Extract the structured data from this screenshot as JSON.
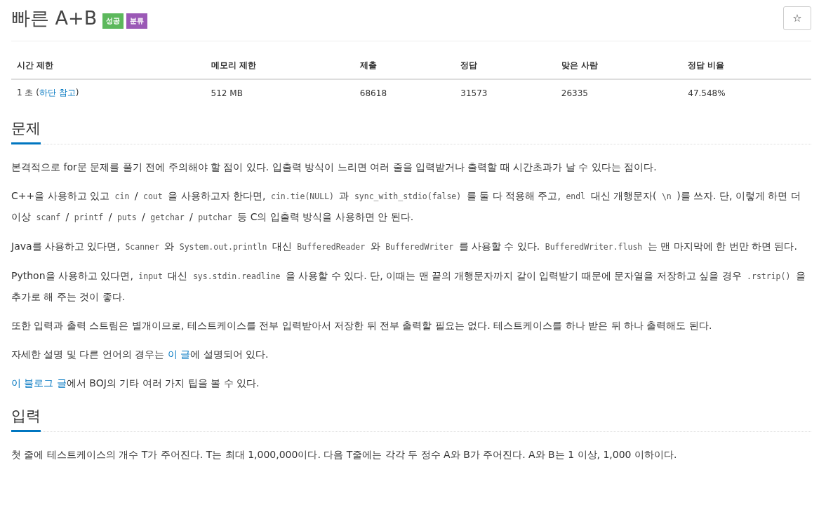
{
  "title": "빠른 A+B",
  "labels": [
    {
      "text": "성공",
      "color": "#5cb85c"
    },
    {
      "text": "분류",
      "color": "#9b59b6"
    }
  ],
  "star_button": "☆",
  "info_table": {
    "columns": [
      "시간 제한",
      "메모리 제한",
      "제출",
      "정답",
      "맞은 사람",
      "정답 비율"
    ],
    "row": [
      [
        {
          "kind": "text",
          "text": "1 초 ("
        },
        {
          "kind": "link",
          "text": "하단 참고"
        },
        {
          "kind": "text",
          "text": ")"
        }
      ],
      [
        {
          "kind": "text",
          "text": "512 MB"
        }
      ],
      [
        {
          "kind": "text",
          "text": "68618"
        }
      ],
      [
        {
          "kind": "text",
          "text": "31573"
        }
      ],
      [
        {
          "kind": "text",
          "text": "26335"
        }
      ],
      [
        {
          "kind": "text",
          "text": "47.548%"
        }
      ]
    ]
  },
  "sections": [
    {
      "heading": "문제",
      "paragraphs": [
        [
          {
            "kind": "text",
            "text": "본격적으로 for문 문제를 풀기 전에 주의해야 할 점이 있다. 입출력 방식이 느리면 여러 줄을 입력받거나 출력할 때 시간초과가 날 수 있다는 점이다."
          }
        ],
        [
          {
            "kind": "text",
            "text": "C++을 사용하고 있고 "
          },
          {
            "kind": "code",
            "text": "cin"
          },
          {
            "kind": "text",
            "text": " / "
          },
          {
            "kind": "code",
            "text": "cout"
          },
          {
            "kind": "text",
            "text": " 을 사용하고자 한다면, "
          },
          {
            "kind": "code",
            "text": "cin.tie(NULL)"
          },
          {
            "kind": "text",
            "text": " 과 "
          },
          {
            "kind": "code",
            "text": "sync_with_stdio(false)"
          },
          {
            "kind": "text",
            "text": " 를 둘 다 적용해 주고, "
          },
          {
            "kind": "code",
            "text": "endl"
          },
          {
            "kind": "text",
            "text": " 대신 개행문자( "
          },
          {
            "kind": "code",
            "text": "\\n"
          },
          {
            "kind": "text",
            "text": " )를 쓰자. 단, 이렇게 하면 더 이상 "
          },
          {
            "kind": "code",
            "text": "scanf"
          },
          {
            "kind": "text",
            "text": " / "
          },
          {
            "kind": "code",
            "text": "printf"
          },
          {
            "kind": "text",
            "text": " / "
          },
          {
            "kind": "code",
            "text": "puts"
          },
          {
            "kind": "text",
            "text": " / "
          },
          {
            "kind": "code",
            "text": "getchar"
          },
          {
            "kind": "text",
            "text": " / "
          },
          {
            "kind": "code",
            "text": "putchar"
          },
          {
            "kind": "text",
            "text": " 등 C의 입출력 방식을 사용하면 안 된다."
          }
        ],
        [
          {
            "kind": "text",
            "text": "Java를 사용하고 있다면, "
          },
          {
            "kind": "code",
            "text": "Scanner"
          },
          {
            "kind": "text",
            "text": " 와 "
          },
          {
            "kind": "code",
            "text": "System.out.println"
          },
          {
            "kind": "text",
            "text": " 대신 "
          },
          {
            "kind": "code",
            "text": "BufferedReader"
          },
          {
            "kind": "text",
            "text": " 와 "
          },
          {
            "kind": "code",
            "text": "BufferedWriter"
          },
          {
            "kind": "text",
            "text": " 를 사용할 수 있다. "
          },
          {
            "kind": "code",
            "text": "BufferedWriter.flush"
          },
          {
            "kind": "text",
            "text": " 는 맨 마지막에 한 번만 하면 된다."
          }
        ],
        [
          {
            "kind": "text",
            "text": "Python을 사용하고 있다면, "
          },
          {
            "kind": "code",
            "text": "input"
          },
          {
            "kind": "text",
            "text": " 대신 "
          },
          {
            "kind": "code",
            "text": "sys.stdin.readline"
          },
          {
            "kind": "text",
            "text": " 을 사용할 수 있다. 단, 이때는 맨 끝의 개행문자까지 같이 입력받기 때문에 문자열을 저장하고 싶을 경우 "
          },
          {
            "kind": "code",
            "text": ".rstrip()"
          },
          {
            "kind": "text",
            "text": " 을 추가로 해 주는 것이 좋다."
          }
        ],
        [
          {
            "kind": "text",
            "text": "또한 입력과 출력 스트림은 별개이므로, 테스트케이스를 전부 입력받아서 저장한 뒤 전부 출력할 필요는 없다. 테스트케이스를 하나 받은 뒤 하나 출력해도 된다."
          }
        ],
        [
          {
            "kind": "text",
            "text": "자세한 설명 및 다른 언어의 경우는 "
          },
          {
            "kind": "link",
            "text": "이 글"
          },
          {
            "kind": "text",
            "text": "에 설명되어 있다."
          }
        ],
        [
          {
            "kind": "link",
            "text": "이 블로그 글"
          },
          {
            "kind": "text",
            "text": "에서 BOJ의 기타 여러 가지 팁을 볼 수 있다."
          }
        ]
      ]
    },
    {
      "heading": "입력",
      "paragraphs": [
        [
          {
            "kind": "text",
            "text": "첫 줄에 테스트케이스의 개수 T가 주어진다. T는 최대 1,000,000이다. 다음 T줄에는 각각 두 정수 A와 B가 주어진다. A와 B는 1 이상, 1,000 이하이다."
          }
        ]
      ]
    }
  ]
}
